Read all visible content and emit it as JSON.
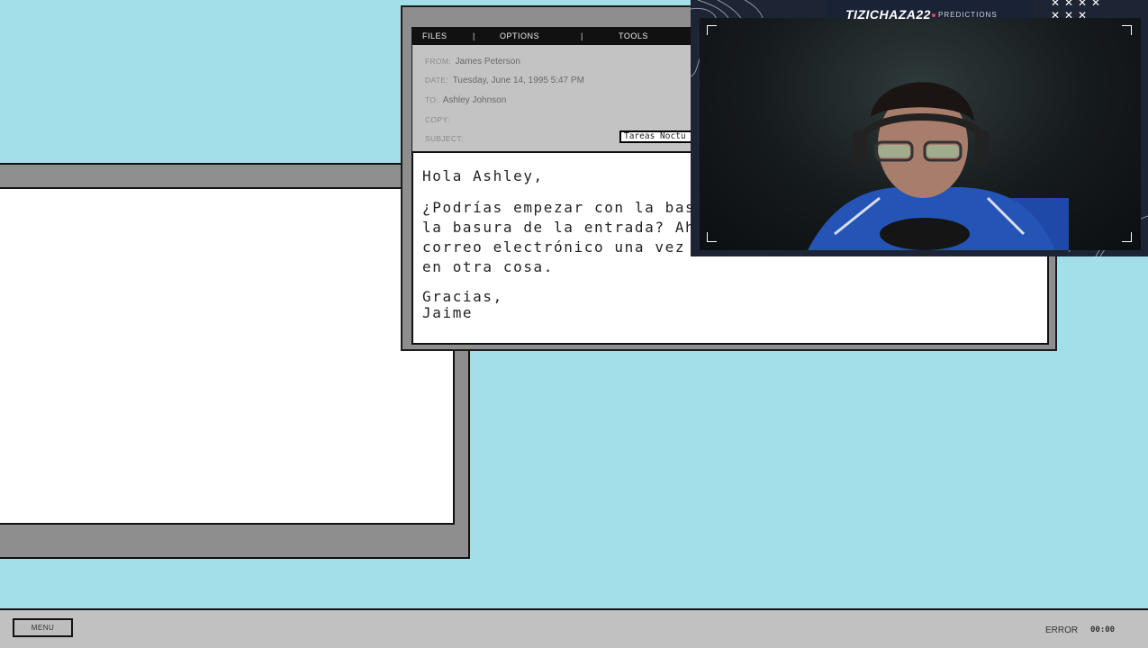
{
  "taskbar": {
    "menu_label": "MENU",
    "status_label": "ERROR",
    "clock": "00:00"
  },
  "mail": {
    "menu": [
      "FILES",
      "OPTIONS",
      "TOOLS"
    ],
    "headers": {
      "from_label": "FROM:",
      "from": "James Peterson",
      "date_label": "DATE:",
      "date": "Tuesday, June 14, 1995 5:47 PM",
      "to_label": "TO:",
      "to": "Ashley Johnson",
      "copy_label": "COPY:",
      "subject_label": "SUBJECT:",
      "subject": "Tareas Noctu"
    },
    "body": {
      "greeting": "Hola Ashley,",
      "paragraph": "¿Podrías empezar con la basur\nla basura de la entrada? Ah,\ncorreo electrónico una vez q\nen otra cosa.",
      "closing": "Gracias,\nJaime"
    }
  },
  "webcam": {
    "channel_name": "TIZICHAZA22",
    "predictions_label": "PREDICTIONS",
    "x_icons": [
      "x",
      "x",
      "x",
      "x",
      "x",
      "x",
      "x"
    ]
  }
}
